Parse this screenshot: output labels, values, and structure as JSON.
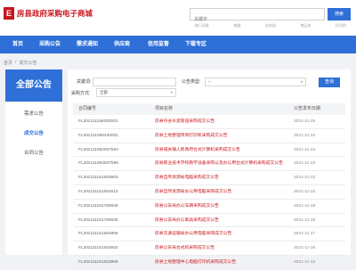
{
  "header": {
    "logo_mark": "E",
    "site_title": "房县政府采购电子商城",
    "search": {
      "placeholder": "关键字",
      "button_label": "搜索"
    },
    "hot_words": [
      "热门词条",
      "电脑",
      "台式机",
      "笔记本",
      "打印机"
    ]
  },
  "nav": {
    "items": [
      "首页",
      "采购公告",
      "需求通知",
      "供应商",
      "信用监督",
      "下载专区"
    ]
  },
  "breadcrumb": {
    "home": "首页",
    "sep": "/",
    "current": "成交公告"
  },
  "sidebar": {
    "title": "全部公告",
    "items": [
      {
        "label": "需求公告",
        "active": false
      },
      {
        "label": "成交公告",
        "active": true
      },
      {
        "label": "合同公告",
        "active": false
      }
    ]
  },
  "filters": {
    "keyword_label": "关键词:",
    "keyword_value": "",
    "type_label": "公告类型:",
    "type_value": "--",
    "method_label": "采购方式:",
    "method_value": "全部",
    "query_button": "查询"
  },
  "table": {
    "columns": [
      "合同编号",
      "项目名称",
      "公告发布日期"
    ],
    "rows": [
      [
        "FL202111158300001",
        "房县丹谷水泥管道采购成交公告",
        "2021-11-25"
      ],
      [
        "FL202111096400001",
        "房县土地整理项目打印机采购成交公告",
        "2021-11-24"
      ],
      [
        "FL202111082657594",
        "房县城关镇人民政府台式计算机采购成交公告",
        "2021-11-24"
      ],
      [
        "FL202111092507595",
        "房县职业技术学校教学设备采购以及办公用台式计算机采购成交公告",
        "2021-11-23"
      ],
      [
        "FL202111151563503",
        "房县自然资源局电脑采购成交公告",
        "2021-11-22"
      ],
      [
        "FL202111151554514",
        "房县自然资源局办公用电脑采购成交公告",
        "2021-11-22"
      ],
      [
        "FL202111151766845",
        "房县公安局办公车辆采购成交公告",
        "2021-11-18"
      ],
      [
        "FL202111151766845",
        "房县公安局办公家具采购成交公告",
        "2021-11-18"
      ],
      [
        "FL202111151564866",
        "房县交通运输局办公用电脑采购成交公告",
        "2021-11-17"
      ],
      [
        "FL202111151563502",
        "房县公安局台式机采购成交公告",
        "2021-11-16"
      ],
      [
        "FL202111151553969",
        "房县土地整理中心电脑打印机采购成交公告",
        "2021-11-13"
      ]
    ]
  }
}
